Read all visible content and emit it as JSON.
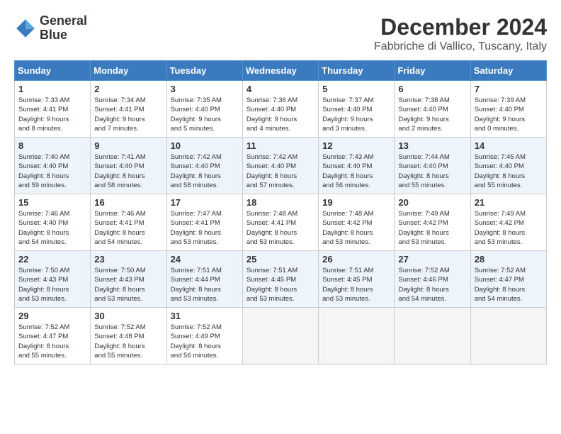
{
  "header": {
    "logo_line1": "General",
    "logo_line2": "Blue",
    "month": "December 2024",
    "location": "Fabbriche di Vallico, Tuscany, Italy"
  },
  "days_of_week": [
    "Sunday",
    "Monday",
    "Tuesday",
    "Wednesday",
    "Thursday",
    "Friday",
    "Saturday"
  ],
  "weeks": [
    [
      {
        "day": "1",
        "info": "Sunrise: 7:33 AM\nSunset: 4:41 PM\nDaylight: 9 hours\nand 8 minutes."
      },
      {
        "day": "2",
        "info": "Sunrise: 7:34 AM\nSunset: 4:41 PM\nDaylight: 9 hours\nand 7 minutes."
      },
      {
        "day": "3",
        "info": "Sunrise: 7:35 AM\nSunset: 4:40 PM\nDaylight: 9 hours\nand 5 minutes."
      },
      {
        "day": "4",
        "info": "Sunrise: 7:36 AM\nSunset: 4:40 PM\nDaylight: 9 hours\nand 4 minutes."
      },
      {
        "day": "5",
        "info": "Sunrise: 7:37 AM\nSunset: 4:40 PM\nDaylight: 9 hours\nand 3 minutes."
      },
      {
        "day": "6",
        "info": "Sunrise: 7:38 AM\nSunset: 4:40 PM\nDaylight: 9 hours\nand 2 minutes."
      },
      {
        "day": "7",
        "info": "Sunrise: 7:39 AM\nSunset: 4:40 PM\nDaylight: 9 hours\nand 0 minutes."
      }
    ],
    [
      {
        "day": "8",
        "info": "Sunrise: 7:40 AM\nSunset: 4:40 PM\nDaylight: 8 hours\nand 59 minutes."
      },
      {
        "day": "9",
        "info": "Sunrise: 7:41 AM\nSunset: 4:40 PM\nDaylight: 8 hours\nand 58 minutes."
      },
      {
        "day": "10",
        "info": "Sunrise: 7:42 AM\nSunset: 4:40 PM\nDaylight: 8 hours\nand 58 minutes."
      },
      {
        "day": "11",
        "info": "Sunrise: 7:42 AM\nSunset: 4:40 PM\nDaylight: 8 hours\nand 57 minutes."
      },
      {
        "day": "12",
        "info": "Sunrise: 7:43 AM\nSunset: 4:40 PM\nDaylight: 8 hours\nand 56 minutes."
      },
      {
        "day": "13",
        "info": "Sunrise: 7:44 AM\nSunset: 4:40 PM\nDaylight: 8 hours\nand 55 minutes."
      },
      {
        "day": "14",
        "info": "Sunrise: 7:45 AM\nSunset: 4:40 PM\nDaylight: 8 hours\nand 55 minutes."
      }
    ],
    [
      {
        "day": "15",
        "info": "Sunrise: 7:46 AM\nSunset: 4:40 PM\nDaylight: 8 hours\nand 54 minutes."
      },
      {
        "day": "16",
        "info": "Sunrise: 7:46 AM\nSunset: 4:41 PM\nDaylight: 8 hours\nand 54 minutes."
      },
      {
        "day": "17",
        "info": "Sunrise: 7:47 AM\nSunset: 4:41 PM\nDaylight: 8 hours\nand 53 minutes."
      },
      {
        "day": "18",
        "info": "Sunrise: 7:48 AM\nSunset: 4:41 PM\nDaylight: 8 hours\nand 53 minutes."
      },
      {
        "day": "19",
        "info": "Sunrise: 7:48 AM\nSunset: 4:42 PM\nDaylight: 8 hours\nand 53 minutes."
      },
      {
        "day": "20",
        "info": "Sunrise: 7:49 AM\nSunset: 4:42 PM\nDaylight: 8 hours\nand 53 minutes."
      },
      {
        "day": "21",
        "info": "Sunrise: 7:49 AM\nSunset: 4:42 PM\nDaylight: 8 hours\nand 53 minutes."
      }
    ],
    [
      {
        "day": "22",
        "info": "Sunrise: 7:50 AM\nSunset: 4:43 PM\nDaylight: 8 hours\nand 53 minutes."
      },
      {
        "day": "23",
        "info": "Sunrise: 7:50 AM\nSunset: 4:43 PM\nDaylight: 8 hours\nand 53 minutes."
      },
      {
        "day": "24",
        "info": "Sunrise: 7:51 AM\nSunset: 4:44 PM\nDaylight: 8 hours\nand 53 minutes."
      },
      {
        "day": "25",
        "info": "Sunrise: 7:51 AM\nSunset: 4:45 PM\nDaylight: 8 hours\nand 53 minutes."
      },
      {
        "day": "26",
        "info": "Sunrise: 7:51 AM\nSunset: 4:45 PM\nDaylight: 8 hours\nand 53 minutes."
      },
      {
        "day": "27",
        "info": "Sunrise: 7:52 AM\nSunset: 4:46 PM\nDaylight: 8 hours\nand 54 minutes."
      },
      {
        "day": "28",
        "info": "Sunrise: 7:52 AM\nSunset: 4:47 PM\nDaylight: 8 hours\nand 54 minutes."
      }
    ],
    [
      {
        "day": "29",
        "info": "Sunrise: 7:52 AM\nSunset: 4:47 PM\nDaylight: 8 hours\nand 55 minutes."
      },
      {
        "day": "30",
        "info": "Sunrise: 7:52 AM\nSunset: 4:48 PM\nDaylight: 8 hours\nand 55 minutes."
      },
      {
        "day": "31",
        "info": "Sunrise: 7:52 AM\nSunset: 4:49 PM\nDaylight: 8 hours\nand 56 minutes."
      },
      {
        "day": "",
        "info": ""
      },
      {
        "day": "",
        "info": ""
      },
      {
        "day": "",
        "info": ""
      },
      {
        "day": "",
        "info": ""
      }
    ]
  ]
}
